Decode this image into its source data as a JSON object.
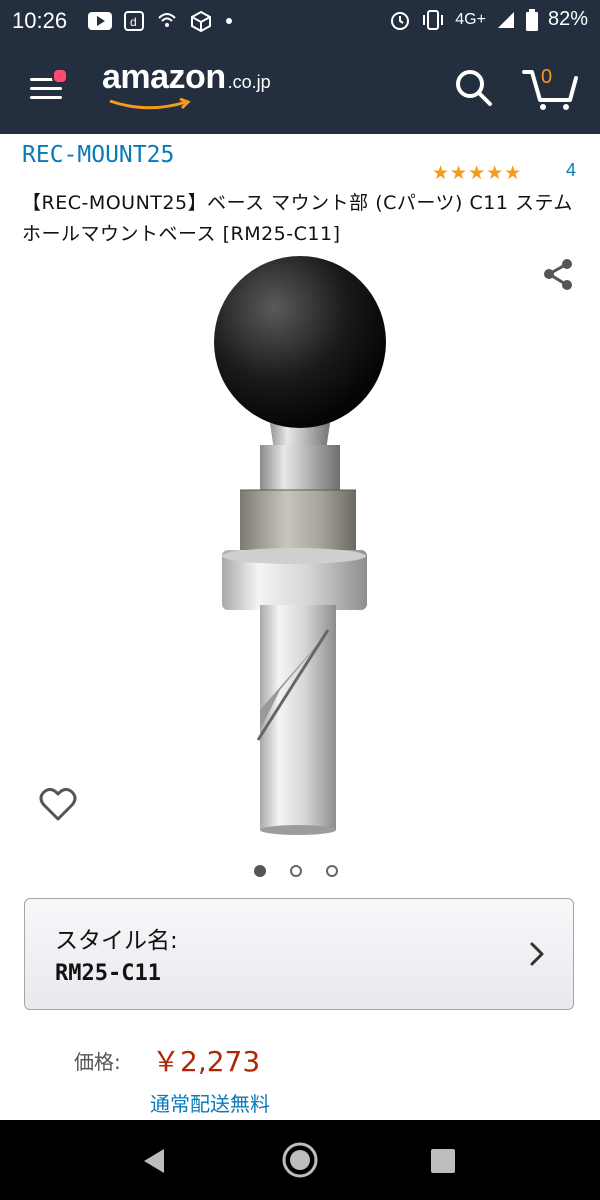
{
  "status_bar": {
    "time": "10:26",
    "network": "4G+",
    "battery": "82%",
    "icons": [
      "youtube-icon",
      "d-app-icon",
      "wifi-calling-icon",
      "ar-icon",
      "dot-icon",
      "alarm-icon",
      "vibrate-icon",
      "signal-icon",
      "battery-icon"
    ]
  },
  "header": {
    "logo_text": "amazon",
    "logo_tld": ".co.jp",
    "cart_count": "0",
    "colors": {
      "background": "#232f3e",
      "accent": "#f79a1c",
      "notification_dot": "#ff4b6e"
    }
  },
  "product": {
    "brand": "REC-MOUNT25",
    "rating_count": "4",
    "rating_stars": 5,
    "title": "【REC-MOUNT25】ベース マウント部 (Cパーツ) C11 ステムホールマウントベース [RM25-C11]",
    "image_count": 3,
    "active_image": 0,
    "style_label": "スタイル名:",
    "style_value": "RM25-C11",
    "price_label": "価格:",
    "price_value": "￥2,273",
    "shipping": "通常配送無料",
    "colors": {
      "link": "#0a7ab8",
      "price": "#b12704",
      "star": "#f59b1c"
    }
  }
}
